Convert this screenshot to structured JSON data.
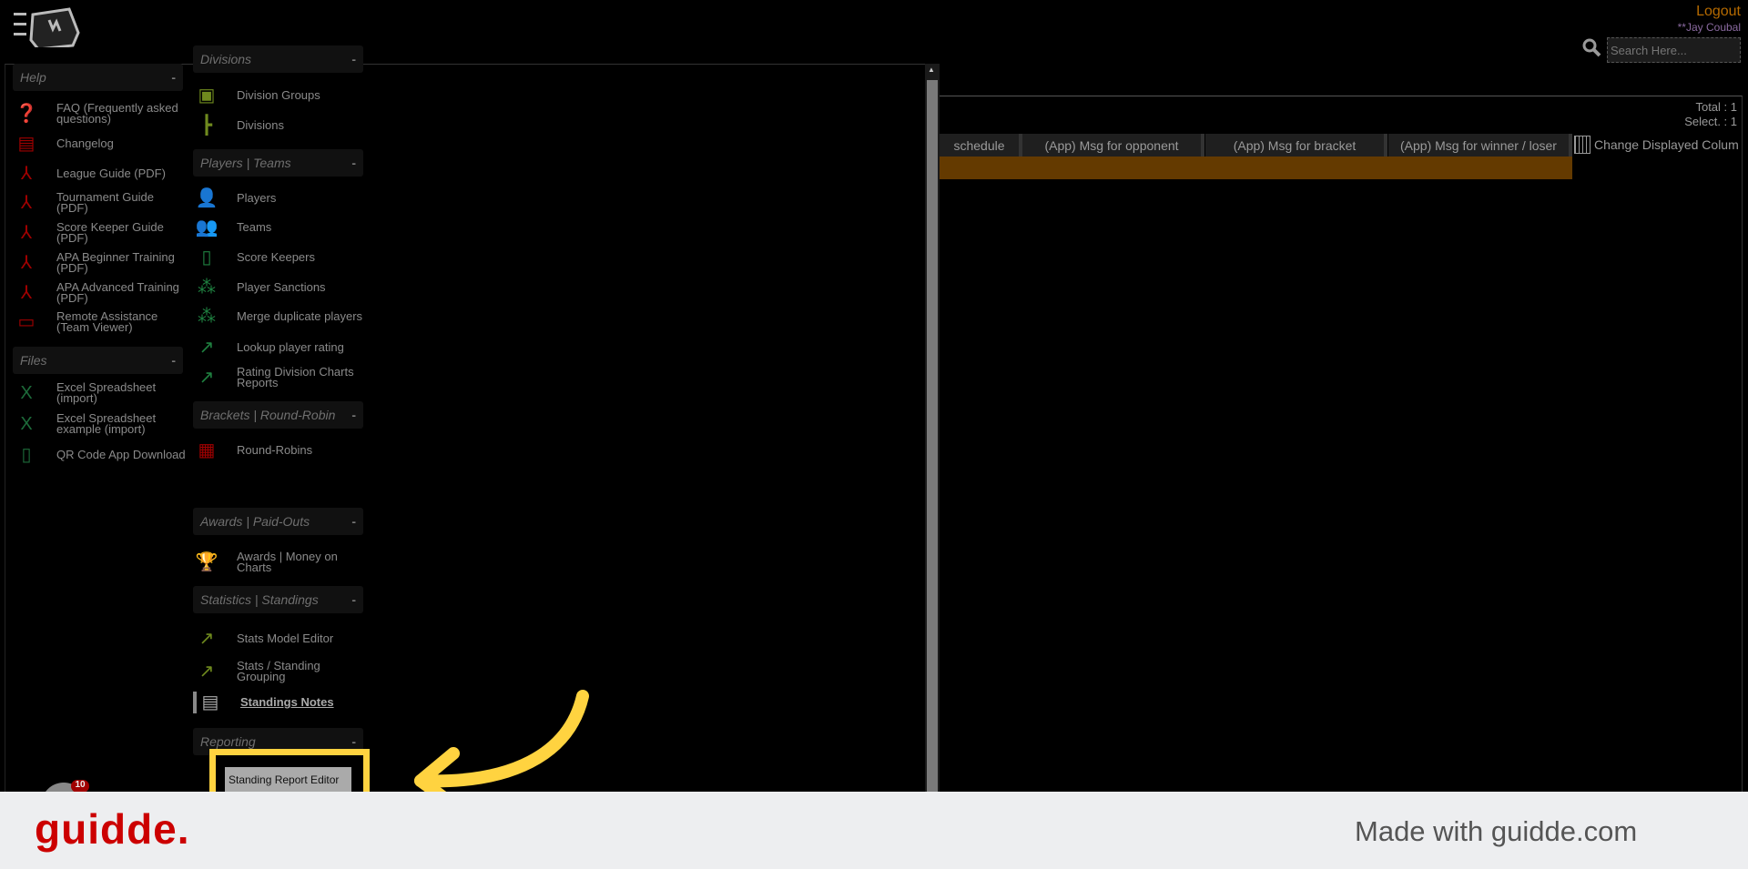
{
  "header": {
    "logout": "Logout",
    "user": "**Jay Coubal",
    "search_placeholder": "Search Here..."
  },
  "left": {
    "help_title": "Help",
    "files_title": "Files",
    "collapse": "-",
    "help": [
      {
        "label": "FAQ (Frequently asked questions)",
        "icon": "question-icon",
        "color": "#a00000"
      },
      {
        "label": "Changelog",
        "icon": "document-icon",
        "color": "#a00000"
      },
      {
        "label": "League Guide (PDF)",
        "icon": "pdf-icon",
        "color": "#a00000"
      },
      {
        "label": "Tournament Guide (PDF)",
        "icon": "pdf-icon",
        "color": "#a00000"
      },
      {
        "label": "Score Keeper Guide (PDF)",
        "icon": "pdf-icon",
        "color": "#a00000"
      },
      {
        "label": "APA Beginner Training (PDF)",
        "icon": "pdf-icon",
        "color": "#a00000"
      },
      {
        "label": "APA Advanced Training (PDF)",
        "icon": "pdf-icon",
        "color": "#a00000"
      },
      {
        "label": "Remote Assistance (Team Viewer)",
        "icon": "remote-screen-icon",
        "color": "#a00000"
      }
    ],
    "files": [
      {
        "label": "Excel Spreadsheet (import)",
        "icon": "excel-icon",
        "color": "#1d6b3a"
      },
      {
        "label": "Excel Spreadsheet example (import)",
        "icon": "excel-icon",
        "color": "#1d6b3a"
      },
      {
        "label": "QR Code App Download",
        "icon": "phone-icon",
        "color": "#1d6b3a"
      }
    ]
  },
  "middle": {
    "sections": [
      {
        "title": "Divisions",
        "items": [
          {
            "label": "Division Groups",
            "icon": "division-groups-icon",
            "color": "#6f8a1e"
          },
          {
            "label": "Divisions",
            "icon": "divisions-tree-icon",
            "color": "#6f8a1e"
          }
        ]
      },
      {
        "title": "Players | Teams",
        "items": [
          {
            "label": "Players",
            "icon": "player-icon",
            "color": "#1f8040"
          },
          {
            "label": "Teams",
            "icon": "team-icon",
            "color": "#1f8040"
          },
          {
            "label": "Score Keepers",
            "icon": "clipboard-icon",
            "color": "#1f8040"
          },
          {
            "label": "Player Sanctions",
            "icon": "group-icon",
            "color": "#1f8040"
          },
          {
            "label": "Merge duplicate players",
            "icon": "group-icon",
            "color": "#1f8040"
          },
          {
            "label": "Lookup player rating",
            "icon": "rating-chart-icon",
            "color": "#1f8040"
          },
          {
            "label": "Rating Division Charts Reports",
            "icon": "rating-chart-icon",
            "color": "#1f8040"
          }
        ]
      },
      {
        "title": "Brackets | Round-Robin",
        "items": [
          {
            "label": "Round-Robins",
            "icon": "grid-icon",
            "color": "#a00000"
          }
        ]
      },
      {
        "title": "Awards | Paid-Outs",
        "items": [
          {
            "label": "Awards | Money on Charts",
            "icon": "trophy-icon",
            "color": "#2a3a8a"
          }
        ]
      },
      {
        "title": "Statistics | Standings",
        "items": [
          {
            "label": "Stats Model Editor",
            "icon": "stats-icon",
            "color": "#6f8a1e"
          },
          {
            "label": "Stats / Standing Grouping",
            "icon": "stats-icon",
            "color": "#6f8a1e"
          },
          {
            "label": "Standings Notes",
            "icon": "notes-icon",
            "color": "#aaaaaa"
          }
        ]
      },
      {
        "title": "Reporting",
        "items": [
          {
            "label": "Standing Report Editor",
            "icon": "report-icon",
            "color": "#888888"
          }
        ]
      }
    ],
    "collapse": "-"
  },
  "table": {
    "total": "Total : 1",
    "selected": "Select. : 1",
    "columns": [
      "schedule",
      "(App) Msg for opponent",
      "(App) Msg for bracket",
      "(App) Msg for winner / loser"
    ],
    "change_columns": "Change Displayed Colum",
    "row_color": "#643a00"
  },
  "badge": "10",
  "footer": {
    "logo": "guidde.",
    "tagline": "Made with guidde.com",
    "brand_color": "#cc0000",
    "highlight_color": "#ffd340"
  }
}
